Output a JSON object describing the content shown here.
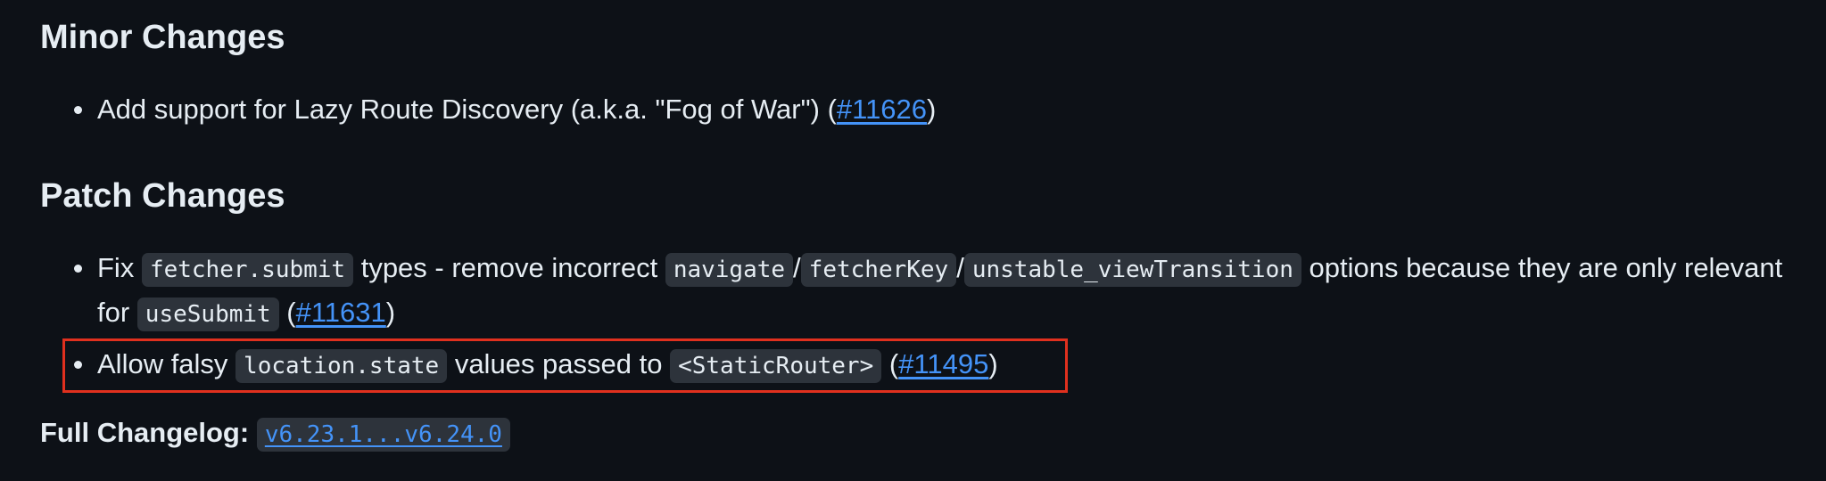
{
  "minor": {
    "heading": "Minor Changes",
    "item1": {
      "text": "Add support for Lazy Route Discovery (a.k.a. \"Fog of War\") (",
      "link": "#11626",
      "close": ")"
    }
  },
  "patch": {
    "heading": "Patch Changes",
    "item1": {
      "fix": "Fix ",
      "code1": "fetcher.submit",
      "t1": " types - remove incorrect ",
      "code2": "navigate",
      "slash1": "/",
      "code3": "fetcherKey",
      "slash2": "/",
      "code4": "unstable_viewTransition",
      "t2": " options because they are only relevant for ",
      "code5": "useSubmit",
      "open": " (",
      "link": "#11631",
      "close": ")"
    },
    "item2": {
      "t1": "Allow falsy ",
      "code1": "location.state",
      "t2": " values passed to ",
      "code2": "<StaticRouter>",
      "open": " (",
      "link": "#11495",
      "close": ")"
    }
  },
  "changelog": {
    "label": "Full Changelog:",
    "link": "v6.23.1...v6.24.0"
  },
  "colors": {
    "background": "#0d1117",
    "text": "#e6edf3",
    "link": "#4493f8",
    "code_bg": "#2d333b",
    "highlight_border": "#e0301e"
  }
}
